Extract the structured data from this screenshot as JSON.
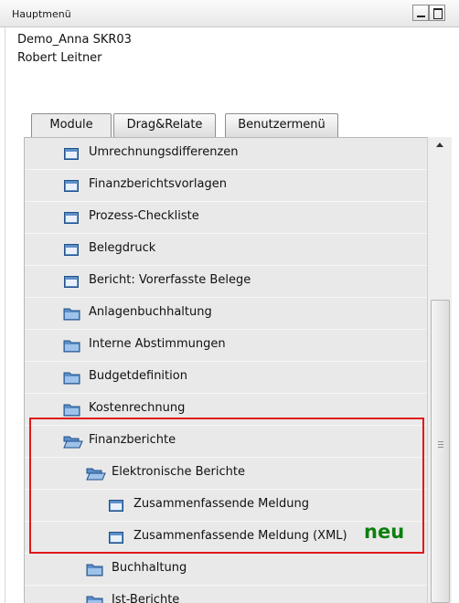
{
  "window": {
    "title": "Hauptmenü"
  },
  "company": {
    "name": "Demo_Anna SKR03",
    "user": "Robert Leitner"
  },
  "tabs": [
    {
      "label": "Module",
      "active": true
    },
    {
      "label": "Drag&Relate",
      "active": false
    },
    {
      "label": "Benutzermenü",
      "active": false
    }
  ],
  "menu": {
    "items": [
      {
        "label": "Umrechnungsdifferenzen",
        "icon": "window-icon"
      },
      {
        "label": "Finanzberichtsvorlagen",
        "icon": "window-icon"
      },
      {
        "label": "Prozess-Checkliste",
        "icon": "window-icon"
      },
      {
        "label": "Belegdruck",
        "icon": "window-icon"
      },
      {
        "label": "Bericht: Vorerfasste Belege",
        "icon": "window-icon"
      },
      {
        "label": "Anlagenbuchhaltung",
        "icon": "folder-icon"
      },
      {
        "label": "Interne Abstimmungen",
        "icon": "folder-icon"
      },
      {
        "label": "Budgetdefinition",
        "icon": "folder-icon"
      },
      {
        "label": "Kostenrechnung",
        "icon": "folder-icon"
      },
      {
        "label": "Finanzberichte",
        "icon": "folder-open-icon"
      },
      {
        "label": "Elektronische Berichte",
        "icon": "folder-open-icon"
      },
      {
        "label": "Zusammenfassende Meldung",
        "icon": "window-icon"
      },
      {
        "label": "Zusammenfassende Meldung (XML)",
        "icon": "window-icon"
      },
      {
        "label": "Buchhaltung",
        "icon": "folder-icon"
      },
      {
        "label": "Ist-Berichte",
        "icon": "folder-icon"
      }
    ]
  },
  "annotation": {
    "text": "neu",
    "color": "#0d7f0d",
    "box_color": "#e0191a"
  }
}
